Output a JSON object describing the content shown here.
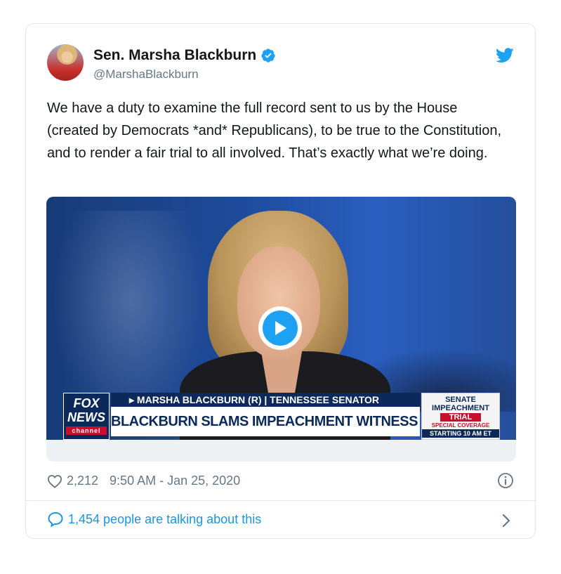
{
  "tweet": {
    "author_name": "Sen. Marsha Blackburn",
    "handle": "@MarshaBlackburn",
    "text": "We have a duty to examine the full record sent to us by the House (created by Democrats *and* Republicans), to be true to the Constitution, and to render a fair trial to all involved. That’s exactly what we’re doing.",
    "likes": "2,212",
    "timestamp": "9:50 AM - Jan 25, 2020",
    "talking": "1,454 people are talking about this"
  },
  "video": {
    "network_logo": [
      "FOX",
      "NEWS",
      "channel"
    ],
    "lower_third_top": "▸ MARSHA BLACKBURN (R) | TENNESSEE SENATOR",
    "headline": "BLACKBURN SLAMS IMPEACHMENT WITNESS AMID TRIAL",
    "bug": [
      "SENATE",
      "IMPEACHMENT",
      "TRIAL",
      "SPECIAL COVERAGE",
      "STARTING 10 AM ET"
    ]
  },
  "icons": {
    "verified": "verified-badge-icon",
    "brand": "twitter-bird-icon",
    "like": "heart-icon",
    "info": "info-icon",
    "reply": "speech-bubble-icon",
    "chevron": "chevron-right-icon",
    "play": "play-icon"
  },
  "colors": {
    "accent": "#1da1f2",
    "link": "#1b95e0",
    "muted": "#657786"
  }
}
